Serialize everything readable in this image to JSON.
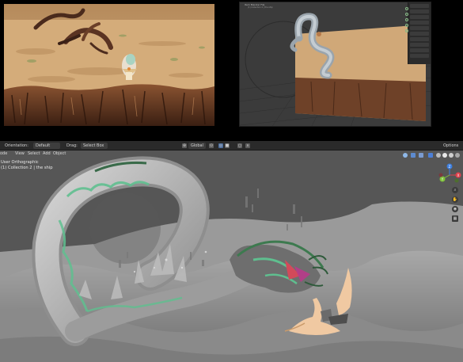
{
  "reference_frame": {
    "colors": {
      "sky": "#c8a170",
      "ground": "#d4ac7a",
      "cliff": "#7b4a2b",
      "dark": "#3a2216"
    }
  },
  "thumbnail": {
    "title": "Item Blender File",
    "subtitle": "(1) Collection 2 | the ship"
  },
  "header": {
    "orientation_label": "Orientation:",
    "default_dropdown": "Default",
    "drag_label": "Drag:",
    "select_box_dropdown": "Select Box",
    "transform_dropdown": "Global",
    "options_label": "Options"
  },
  "menu": {
    "mode_label": "ode",
    "items": [
      "View",
      "Select",
      "Add",
      "Object"
    ]
  },
  "overlay": {
    "view_name": "User Orthographic",
    "collection_info": "(1) Collection 2 | the ship"
  },
  "gizmo": {
    "axis_x": "X",
    "axis_y": "Y",
    "axis_z": "Z"
  },
  "colors": {
    "viewport_bg": "#565656",
    "header_bg": "#2a2a2a",
    "accent_green": "#5fbf8f",
    "accent_red": "#d24a5a",
    "axis_x": "#e0424d",
    "axis_y": "#7fc13b",
    "axis_z": "#3d7fe0",
    "horn": "#f0c9a2"
  }
}
